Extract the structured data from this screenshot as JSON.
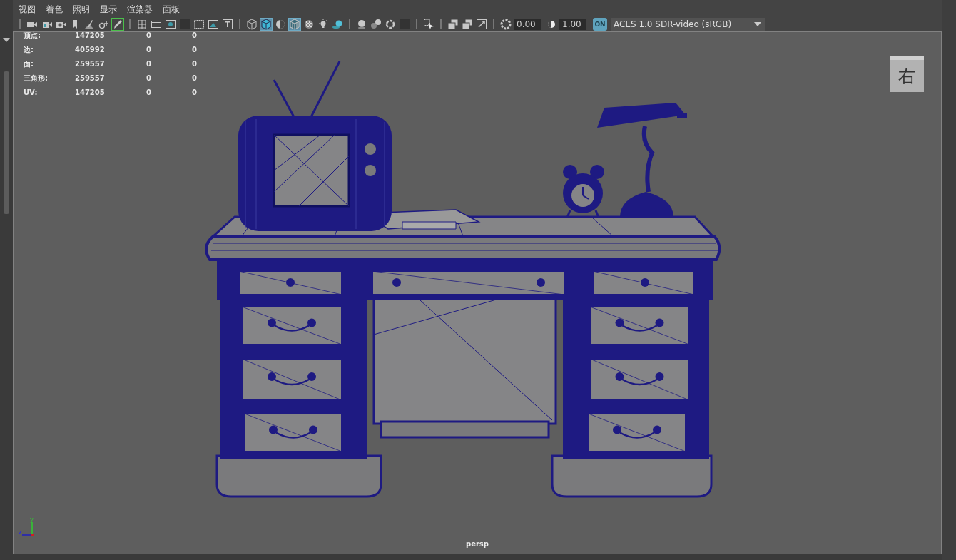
{
  "menu": [
    "视图",
    "着色",
    "照明",
    "显示",
    "渲染器",
    "面板"
  ],
  "toolbar_groups": [
    [
      {
        "kind": "camera",
        "on": false
      },
      {
        "kind": "camera-lock",
        "on": false
      },
      {
        "kind": "camera-loop",
        "on": false
      },
      {
        "kind": "bookmark",
        "on": false
      },
      {
        "kind": "surface-pen",
        "on": false
      },
      {
        "kind": "pivot",
        "on": false
      },
      {
        "kind": "pencil",
        "on": true
      }
    ],
    [
      {
        "kind": "grid",
        "on": false
      },
      {
        "kind": "film-strip",
        "on": false
      },
      {
        "kind": "gate-dot",
        "on": false
      },
      {
        "kind": "dark-square",
        "on": false
      },
      {
        "kind": "dashed-square",
        "on": false
      },
      {
        "kind": "picture",
        "on": false
      },
      {
        "kind": "text-frame",
        "on": false
      }
    ],
    [
      {
        "kind": "wire-cube",
        "on": false
      },
      {
        "kind": "solid-cube",
        "on": true
      },
      {
        "kind": "half-sphere",
        "on": false
      },
      {
        "kind": "wire-solid-cube",
        "on": true
      },
      {
        "kind": "checker",
        "on": false
      },
      {
        "kind": "bulb",
        "on": false
      },
      {
        "kind": "shadow-sphere",
        "on": false
      }
    ],
    [
      {
        "kind": "ball",
        "on": false
      },
      {
        "kind": "ball-pair",
        "on": false
      },
      {
        "kind": "ring",
        "on": false
      },
      {
        "kind": "dark-square",
        "on": false
      }
    ],
    [
      {
        "kind": "select-arrow",
        "on": false
      }
    ],
    [
      {
        "kind": "layer-stack",
        "on": false
      },
      {
        "kind": "layer-stack",
        "on": false
      },
      {
        "kind": "pin-square",
        "on": false
      }
    ]
  ],
  "exposure": {
    "value": "0.00"
  },
  "gamma": {
    "value": "1.00"
  },
  "color_management": {
    "label": "ON",
    "on": true
  },
  "view_transform": "ACES 1.0 SDR-video (sRGB)",
  "stats": [
    {
      "label": "顶点:",
      "value": "147205",
      "column_3": "0",
      "column_4": "0"
    },
    {
      "label": "边:",
      "value": "405992",
      "column_3": "0",
      "column_4": "0"
    },
    {
      "label": "面:",
      "value": "259557",
      "column_3": "0",
      "column_4": "0"
    },
    {
      "label": "三角形:",
      "value": "259557",
      "column_3": "0",
      "column_4": "0"
    },
    {
      "label": "UV:",
      "value": "147205",
      "column_3": "0",
      "column_4": "0"
    }
  ],
  "view_cube": {
    "label": "右"
  },
  "axis_labels": {
    "vertical": "y",
    "horizontal": "z"
  },
  "camera_name": "persp"
}
